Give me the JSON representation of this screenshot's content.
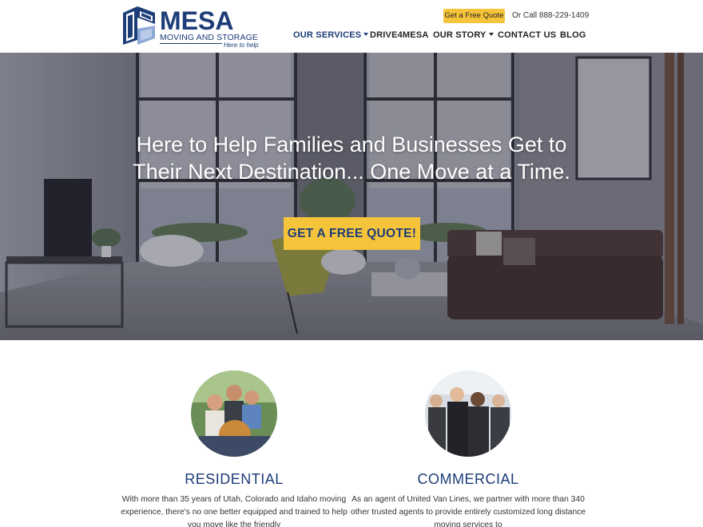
{
  "logo": {
    "title": "MESA",
    "subtitle": "MOVING AND STORAGE",
    "tagline": "Here to help"
  },
  "header": {
    "quote_button": "Get a Free Quote",
    "call_text": "Or Call 888-229-1409"
  },
  "nav": {
    "items": [
      {
        "label": "OUR SERVICES",
        "dropdown": true,
        "active": true
      },
      {
        "label": "DRIVE4MESA",
        "dropdown": false,
        "active": false
      },
      {
        "label": "OUR STORY",
        "dropdown": true,
        "active": false
      },
      {
        "label": "CONTACT US",
        "dropdown": false,
        "active": false
      },
      {
        "label": "BLOG",
        "dropdown": false,
        "active": false
      }
    ]
  },
  "hero": {
    "title": "Here to Help Families and Businesses Get to Their Next Destination... One Move at a Time.",
    "cta_label": "GET A FREE QUOTE!"
  },
  "services": {
    "residential": {
      "title": "RESIDENTIAL",
      "text": "With more than 35 years of Utah, Colorado and Idaho moving experience, there's no one better equipped and trained to help you move like the friendly"
    },
    "commercial": {
      "title": "COMMERCIAL",
      "text": "As an agent of United Van Lines, we partner with more than 340 other trusted agents to provide entirely customized long distance moving services to"
    }
  },
  "colors": {
    "brand_blue": "#1d3d78",
    "accent_yellow": "#f6c43a"
  },
  "icons": {
    "logo_mark": "stacked-boxes-logo-icon",
    "dropdown": "caret-down-icon"
  }
}
